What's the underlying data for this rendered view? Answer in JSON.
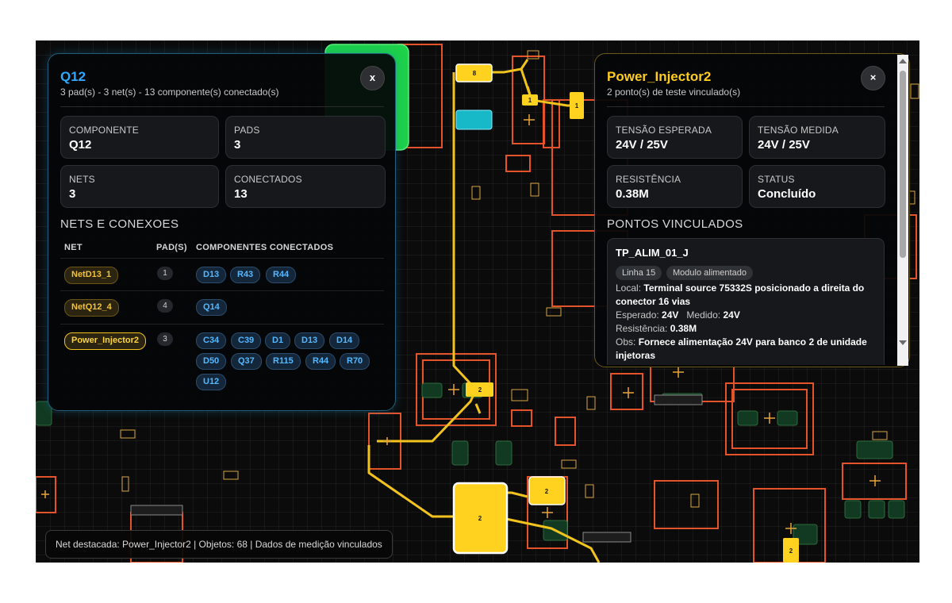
{
  "board": {
    "pad_labels": [
      "8",
      "1",
      "1",
      "2",
      "2",
      "2",
      "2"
    ],
    "colors": {
      "background": "#0b0b0b",
      "trace": "#f2c31f",
      "outline": "#e5532a",
      "pad_highlight": "#ffd21f"
    }
  },
  "left_panel": {
    "title": "Q12",
    "subtitle": "3 pad(s) - 3 net(s) - 13 componente(s) conectado(s)",
    "close_label": "x",
    "cards": [
      {
        "label": "COMPONENTE",
        "value": "Q12"
      },
      {
        "label": "PADS",
        "value": "3"
      },
      {
        "label": "NETS",
        "value": "3"
      },
      {
        "label": "CONECTADOS",
        "value": "13"
      }
    ],
    "section_title": "NETS E CONEXOES",
    "table_headers": [
      "NET",
      "PAD(S)",
      "COMPONENTES CONECTADOS"
    ],
    "rows": [
      {
        "net": "NetD13_1",
        "pads": "1",
        "components": [
          "D13",
          "R43",
          "R44"
        ]
      },
      {
        "net": "NetQ12_4",
        "pads": "4",
        "components": [
          "Q14"
        ]
      },
      {
        "net": "Power_Injector2",
        "pads": "3",
        "components": [
          "C34",
          "C39",
          "D1",
          "D13",
          "D14",
          "D50",
          "Q37",
          "R115",
          "R44",
          "R70",
          "U12"
        ]
      }
    ]
  },
  "right_panel": {
    "title": "Power_Injector2",
    "subtitle": "2 ponto(s) de teste vinculado(s)",
    "close_label": "×",
    "cards": [
      {
        "label": "TENSÃO ESPERADA",
        "value": "24V / 25V"
      },
      {
        "label": "TENSÃO MEDIDA",
        "value": "24V / 25V"
      },
      {
        "label": "RESISTÊNCIA",
        "value": "0.38M"
      },
      {
        "label": "STATUS",
        "value": "Concluído"
      }
    ],
    "section_title": "PONTOS VINCULADOS",
    "point": {
      "name": "TP_ALIM_01_J",
      "tags": [
        "Linha 15",
        "Modulo alimentado"
      ],
      "local_label": "Local:",
      "local_value": "Terminal source 75332S posicionado a direita do",
      "local_value_2": "conector 16 vias",
      "expected_label": "Esperado:",
      "expected_value": "24V",
      "measured_label": "Medido:",
      "measured_value": "24V",
      "resistance_label": "Resistência:",
      "resistance_value": "0.38M",
      "obs_label": "Obs:",
      "obs_value": "Fornece alimentação 24V para banco 2 de unidade",
      "obs_value_2": "injetoras"
    }
  },
  "status_bar": "Net destacada: Power_Injector2 | Objetos: 68 | Dados de medição vinculados"
}
